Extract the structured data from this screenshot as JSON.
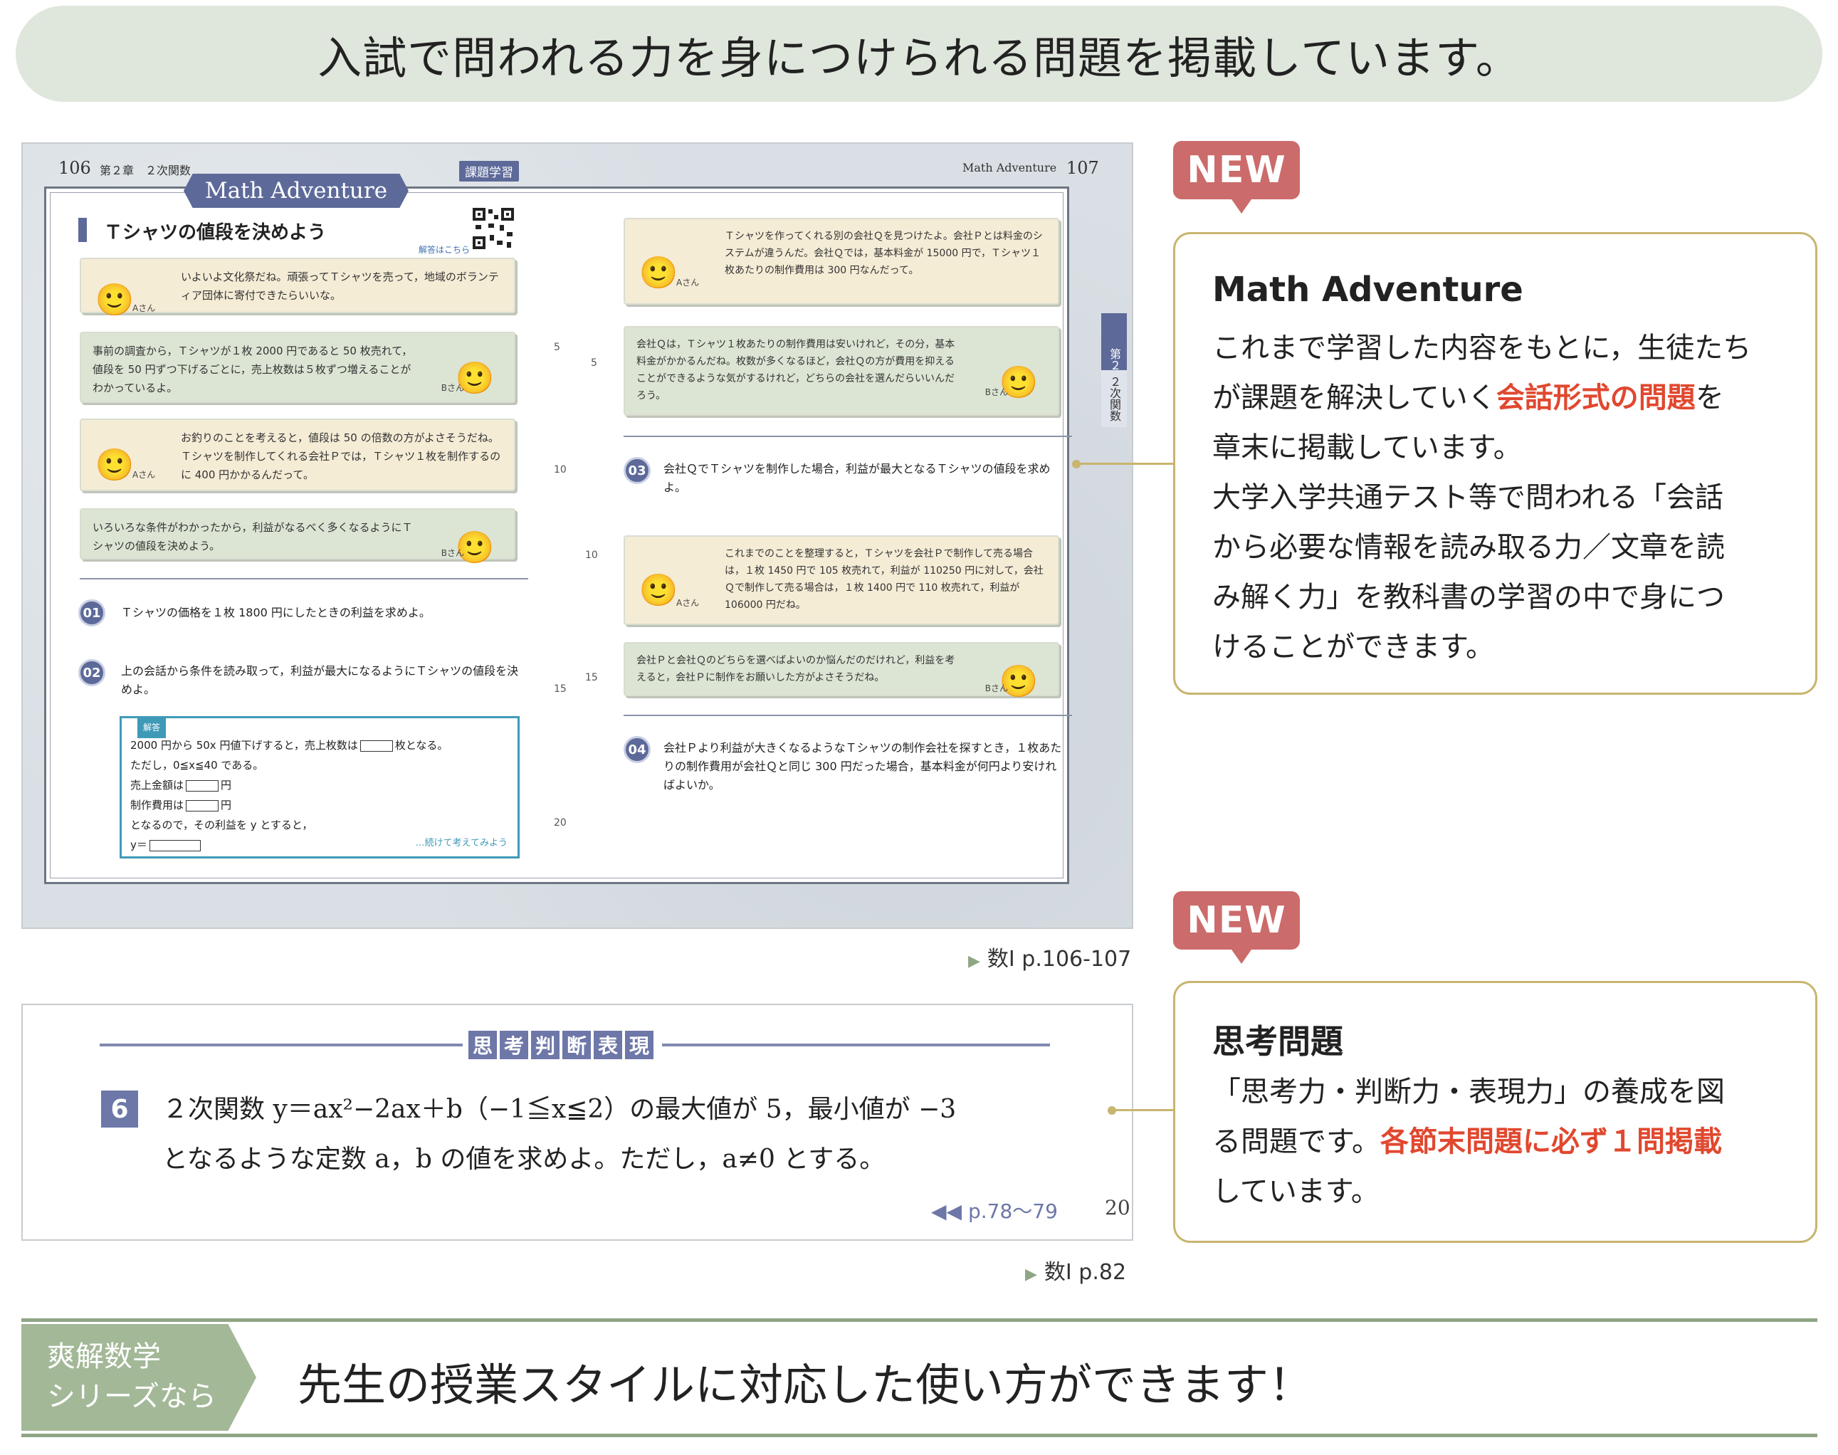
{
  "top_banner": "入試で問われる力を身につけられる問題を掲載しています。",
  "spread": {
    "left_page_no": "106",
    "left_chapter": "第２章　２次関数",
    "left_tag": "課題学習",
    "right_header": "Math Adventure",
    "right_page_no": "107",
    "ribbon": "Math Adventure",
    "section_title": "Ｔシャツの値段を決めよう",
    "qr_caption": "解答はこちら",
    "left_bubbles": [
      {
        "speaker": "Aさん",
        "text": "いよいよ文化祭だね。頑張ってＴシャツを売って，地域のボランティア団体に寄付できたらいいな。"
      },
      {
        "speaker": "Bさん",
        "text": "事前の調査から，Ｔシャツが１枚 2000 円であると 50 枚売れて，値段を 50 円ずつ下げるごとに，売上枚数は５枚ずつ増えることがわかっているよ。"
      },
      {
        "speaker": "Aさん",
        "text": "お釣りのことを考えると，値段は 50 の倍数の方がよさそうだね。Ｔシャツを制作してくれる会社Ｐでは，Ｔシャツ１枚を制作するのに 400 円かかるんだって。"
      },
      {
        "speaker": "Bさん",
        "text": "いろいろな条件がわかったから，利益がなるべく多くなるようにＴシャツの値段を決めよう。"
      }
    ],
    "q01": {
      "num": "01",
      "text": "Ｔシャツの価格を１枚 1800 円にしたときの利益を求めよ。"
    },
    "q02": {
      "num": "02",
      "text": "上の会話から条件を読み取って，利益が最大になるようにＴシャツの値段を決めよ。"
    },
    "answer": {
      "tag": "解答",
      "line1a": "2000 円から 50x 円値下げすると，売上枚数は",
      "line1b": "枚となる。",
      "line2": "ただし，0≦x≦40 である。",
      "line3a": "売上金額は",
      "line3b": "円",
      "line4a": "制作費用は",
      "line4b": "円",
      "line5": "となるので，その利益を y とすると，",
      "line6": "y＝",
      "hint": "…続けて考えてみよう"
    },
    "line_numbers_left": [
      "5",
      "10",
      "15",
      "20"
    ],
    "line_numbers_right": [
      "5",
      "10",
      "15"
    ],
    "right_bubbles": [
      {
        "speaker": "Aさん",
        "text": "Ｔシャツを作ってくれる別の会社Ｑを見つけたよ。会社Ｐとは料金のシステムが違うんだ。会社Ｑでは，基本料金が 15000 円で，Ｔシャツ１枚あたりの制作費用は 300 円なんだって。"
      },
      {
        "speaker": "Bさん",
        "text": "会社Ｑは，Ｔシャツ１枚あたりの制作費用は安いけれど，その分，基本料金がかかるんだね。枚数が多くなるほど，会社Ｑの方が費用を抑えることができるような気がするけれど，どちらの会社を選んだらいいんだろう。"
      },
      {
        "speaker": "Aさん",
        "text": "これまでのことを整理すると，Ｔシャツを会社Ｐで制作して売る場合は，１枚 1450 円で 105 枚売れて，利益が 110250 円に対して，会社Ｑで制作して売る場合は，１枚 1400 円で 110 枚売れて，利益が 106000 円だね。"
      },
      {
        "speaker": "Bさん",
        "text": "会社Ｐと会社Ｑのどちらを選べばよいのか悩んだのだけれど，利益を考えると，会社Ｐに制作をお願いした方がよさそうだね。"
      }
    ],
    "q03": {
      "num": "03",
      "text": "会社ＱでＴシャツを制作した場合，利益が最大となるＴシャツの値段を求めよ。"
    },
    "q04": {
      "num": "04",
      "text": "会社Ｐより利益が大きくなるようなＴシャツの制作会社を探すとき，１枚あたりの制作費用が会社Ｑと同じ 300 円だった場合，基本料金が何円より安ければよいか。"
    },
    "side_tab_top": "第２章",
    "side_tab_bottom": "２次関数"
  },
  "caption1": "数Ⅰ p.106-107",
  "think": {
    "heading_chars": [
      "思",
      "考",
      "判",
      "断",
      "表",
      "現"
    ],
    "num": "6",
    "line1": "２次関数 y＝ax²−2ax＋b（−1≦x≦2）の最大値が 5，最小値が −3",
    "line2": "となるような定数 a，b の値を求めよ。ただし，a≠0 とする。",
    "ref": "◀◀ p.78〜79",
    "line_no": "20"
  },
  "caption2": "数Ⅰ p.82",
  "callout1": {
    "badge": "NEW",
    "title": "Math Adventure",
    "l1": "これまで学習した内容をもとに，生徒たち",
    "l2a": "が課題を解決していく",
    "l2b": "会話形式の問題",
    "l2c": "を",
    "l3": "章末に掲載しています。",
    "l4": "大学入学共通テスト等で問われる「会話",
    "l5": "から必要な情報を読み取る力／文章を読",
    "l6": "み解く力」を教科書の学習の中で身につ",
    "l7": "けることができます。"
  },
  "callout2": {
    "badge": "NEW",
    "title": "思考問題",
    "l1": "「思考力・判断力・表現力」の養成を図",
    "l2a": "る問題です。",
    "l2b": "各節末問題に必ず１問掲載",
    "l3": "しています。"
  },
  "bottom": {
    "pill_l1": "爽解数学",
    "pill_l2": "シリーズなら",
    "tagline": "先生の授業スタイルに対応した使い方ができます！"
  },
  "colors": {
    "accent_navy": "#5d6a99",
    "accent_red": "#e0482f",
    "badge_red": "#cc6b6b",
    "callout_border": "#c8b56e",
    "green": "#8fa684"
  }
}
